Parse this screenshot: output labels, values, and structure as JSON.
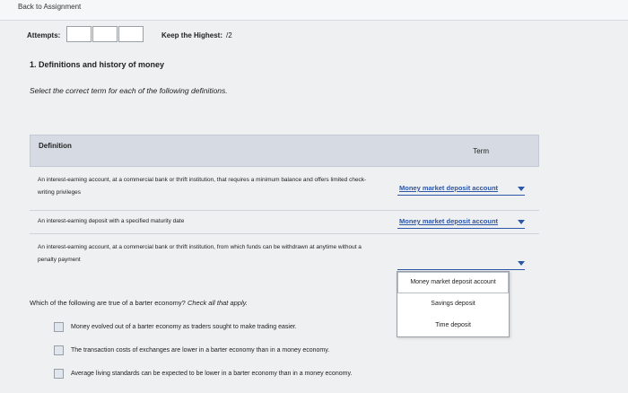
{
  "nav": {
    "back_label": "Back to Assignment"
  },
  "attempts": {
    "label": "Attempts:",
    "boxes": [
      "",
      "",
      ""
    ]
  },
  "keep_highest": {
    "label": "Keep the Highest:",
    "value": "/2"
  },
  "question1": {
    "title": "1. Definitions and history of money",
    "instruction": "Select the correct term for each of the following definitions.",
    "table": {
      "col_definition": "Definition",
      "col_term": "Term",
      "rows": [
        {
          "definition": "An interest-earning account, at a commercial bank or thrift institution, that requires a minimum balance and offers limited check-writing privileges",
          "selected": "Money market deposit account"
        },
        {
          "definition": "An interest-earning deposit with a specified maturity date",
          "selected": "Money market deposit account"
        },
        {
          "definition": "An interest-earning account, at a commercial bank or thrift institution, from which funds can be withdrawn at anytime without a penalty payment",
          "selected": ""
        }
      ]
    },
    "dropdown_options": [
      "Money market deposit account",
      "Savings deposit",
      "Time deposit"
    ]
  },
  "question2": {
    "prompt": "Which of the following are true of a barter economy?",
    "hint": "Check all that apply.",
    "choices": [
      "Money evolved out of a barter economy as traders sought to make trading easier.",
      "The transaction costs of exchanges are lower in a barter economy than in a money economy.",
      "Average living standards can be expected to be lower in a barter economy than in a money economy."
    ]
  },
  "colors": {
    "accent": "#2c56a8",
    "header_bg": "#d6dbe3",
    "page_bg": "#eef0f2"
  }
}
